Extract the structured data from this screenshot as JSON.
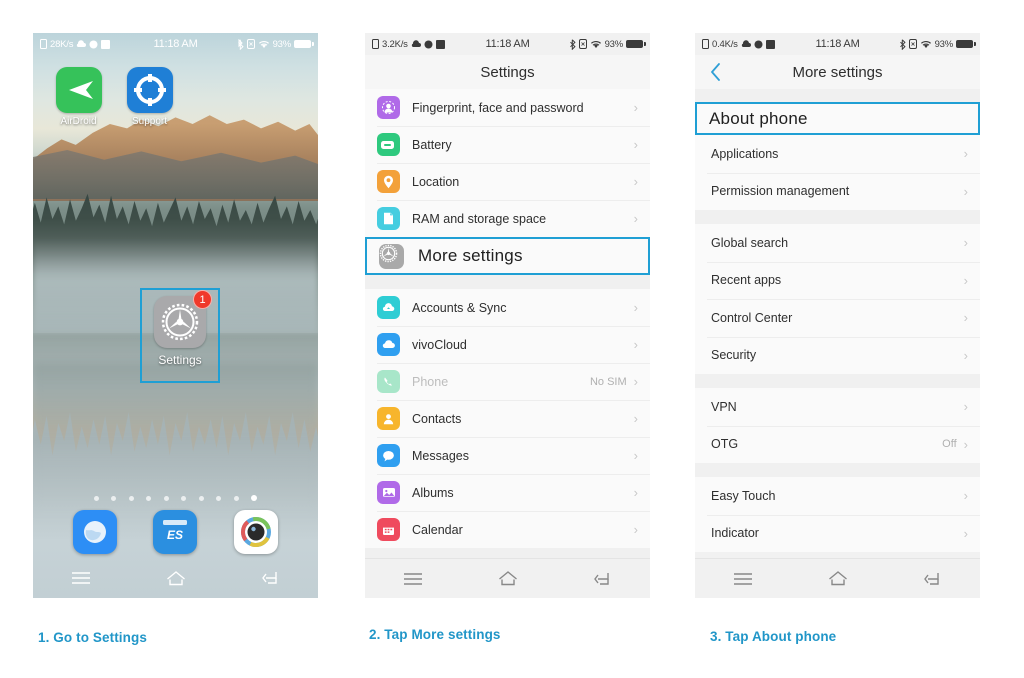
{
  "captions": [
    {
      "text": "1. Go to Settings"
    },
    {
      "text": "2. Tap More settings"
    },
    {
      "text": "3. Tap About phone"
    }
  ],
  "colors": {
    "highlight_border": "#1f9fd4",
    "caption_blue": "#2196c8",
    "badge_red": "#f0392b",
    "list_bg": "#fafafa",
    "group_gap": "#f0f0f0"
  },
  "phone1": {
    "status": {
      "network_speed": "28K/s",
      "time": "11:18 AM",
      "battery_percent": "93%",
      "icons": [
        "sim-card-icon",
        "cloud-icon",
        "app-icon",
        "network-icon",
        "bluetooth-icon",
        "alarm-icon",
        "wifi-icon",
        "battery-icon"
      ]
    },
    "apps": [
      {
        "label": "AirDroid",
        "icon": "airdroid-icon"
      },
      {
        "label": "Support",
        "icon": "support-icon"
      }
    ],
    "selected_app": {
      "label": "Settings",
      "icon": "settings-gear-icon",
      "badge": "1"
    },
    "dock": [
      {
        "label": "Browser",
        "icon": "browser-icon"
      },
      {
        "label": "ES File Explorer",
        "icon": "es-file-explorer-icon"
      },
      {
        "label": "Camera",
        "icon": "camera-icon"
      }
    ],
    "page_dots": {
      "count": 10,
      "active_index": 9
    },
    "navbar": [
      "menu-icon",
      "home-icon",
      "back-icon"
    ]
  },
  "phone2": {
    "status": {
      "network_speed": "3.2K/s",
      "time": "11:18 AM",
      "battery_percent": "93%"
    },
    "title": "Settings",
    "group1": [
      {
        "label": "Fingerprint, face and password",
        "icon": "fingerprint-icon",
        "icon_color": "#b06ae8",
        "value": ""
      },
      {
        "label": "Battery",
        "icon": "battery-icon",
        "icon_color": "#2ec97e",
        "value": ""
      },
      {
        "label": "Location",
        "icon": "location-pin-icon",
        "icon_color": "#f3a13a",
        "value": ""
      },
      {
        "label": "RAM and storage space",
        "icon": "storage-icon",
        "icon_color": "#45cde0",
        "value": ""
      }
    ],
    "highlighted": {
      "label": "More settings",
      "icon": "settings-gear-icon",
      "icon_color": "#a9a9a9"
    },
    "group2": [
      {
        "label": "Accounts & Sync",
        "icon": "accounts-sync-icon",
        "icon_color": "#2ecdd4",
        "value": "",
        "dim": false
      },
      {
        "label": "vivoCloud",
        "icon": "cloud-icon",
        "icon_color": "#2f9ff0",
        "value": "",
        "dim": false
      },
      {
        "label": "Phone",
        "icon": "phone-icon",
        "icon_color": "#a8e6c9",
        "value": "No SIM",
        "dim": true
      },
      {
        "label": "Contacts",
        "icon": "contacts-icon",
        "icon_color": "#f7b52c",
        "value": "",
        "dim": false
      },
      {
        "label": "Messages",
        "icon": "messages-icon",
        "icon_color": "#2f9ff0",
        "value": "",
        "dim": false
      },
      {
        "label": "Albums",
        "icon": "albums-icon",
        "icon_color": "#b06ae8",
        "value": "",
        "dim": false
      },
      {
        "label": "Calendar",
        "icon": "calendar-icon",
        "icon_color": "#ef4b5e",
        "value": "",
        "dim": false
      }
    ],
    "navbar": [
      "menu-icon",
      "home-icon",
      "back-icon"
    ]
  },
  "phone3": {
    "status": {
      "network_speed": "0.4K/s",
      "time": "11:18 AM",
      "battery_percent": "93%"
    },
    "title": "More settings",
    "back_icon": "chevron-left-icon",
    "highlighted": {
      "label": "About phone"
    },
    "group1": [
      {
        "label": "Applications",
        "value": ""
      },
      {
        "label": "Permission management",
        "value": ""
      }
    ],
    "group2": [
      {
        "label": "Global search",
        "value": ""
      },
      {
        "label": "Recent apps",
        "value": ""
      },
      {
        "label": "Control Center",
        "value": ""
      },
      {
        "label": "Security",
        "value": ""
      }
    ],
    "group3": [
      {
        "label": "VPN",
        "value": ""
      },
      {
        "label": "OTG",
        "value": "Off"
      }
    ],
    "group4": [
      {
        "label": "Easy Touch",
        "value": ""
      },
      {
        "label": "Indicator",
        "value": ""
      }
    ],
    "navbar": [
      "menu-icon",
      "home-icon",
      "back-icon"
    ]
  }
}
